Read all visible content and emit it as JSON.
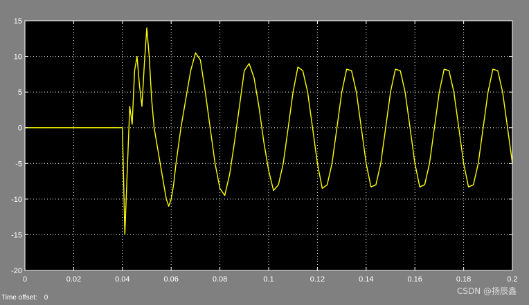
{
  "window": {
    "background": "#808080",
    "plot_background": "#000000",
    "axis_color": "#ffffff",
    "grid_color": "#ffffff",
    "trace_color": "#ffff00"
  },
  "status": {
    "time_offset_label": "Time offset:",
    "time_offset_value": "0"
  },
  "watermark": "CSDN @扬辰鑫",
  "chart_data": {
    "type": "line",
    "title": "",
    "xlabel": "",
    "ylabel": "",
    "xlim": [
      0,
      0.2
    ],
    "ylim": [
      -20,
      15
    ],
    "grid": true,
    "grid_style": "dotted",
    "xticks": [
      0,
      0.02,
      0.04,
      0.06,
      0.08,
      0.1,
      0.12,
      0.14,
      0.16,
      0.18,
      0.2
    ],
    "xtick_labels": [
      "0",
      "0.02",
      "0.04",
      "0.06",
      "0.08",
      "0.1",
      "0.12",
      "0.14",
      "0.16",
      "0.18",
      "0.2"
    ],
    "yticks": [
      -20,
      -15,
      -10,
      -5,
      0,
      5,
      10,
      15
    ],
    "ytick_labels": [
      "-20",
      "-15",
      "-10",
      "-5",
      "0",
      "5",
      "10",
      "15"
    ],
    "series": [
      {
        "color": "#ffff00",
        "x": [
          0,
          0.04,
          0.041,
          0.042,
          0.043,
          0.044,
          0.045,
          0.046,
          0.047,
          0.048,
          0.049,
          0.05,
          0.051,
          0.052,
          0.053,
          0.054,
          0.055,
          0.056,
          0.057,
          0.058,
          0.059,
          0.06,
          0.061,
          0.062,
          0.064,
          0.066,
          0.068,
          0.07,
          0.072,
          0.074,
          0.076,
          0.078,
          0.08,
          0.082,
          0.084,
          0.086,
          0.088,
          0.09,
          0.092,
          0.094,
          0.096,
          0.098,
          0.1,
          0.102,
          0.104,
          0.106,
          0.108,
          0.11,
          0.112,
          0.114,
          0.116,
          0.118,
          0.12,
          0.122,
          0.124,
          0.126,
          0.128,
          0.13,
          0.132,
          0.134,
          0.136,
          0.138,
          0.14,
          0.142,
          0.144,
          0.146,
          0.148,
          0.15,
          0.152,
          0.154,
          0.156,
          0.158,
          0.16,
          0.162,
          0.164,
          0.166,
          0.168,
          0.17,
          0.172,
          0.174,
          0.176,
          0.178,
          0.18,
          0.182,
          0.184,
          0.186,
          0.188,
          0.19,
          0.192,
          0.194,
          0.196,
          0.198,
          0.2
        ],
        "y": [
          0,
          0,
          -15,
          -6,
          3,
          0.5,
          8,
          10,
          6,
          3,
          9,
          14,
          10,
          4,
          0,
          -2,
          -4,
          -6,
          -8,
          -10,
          -11,
          -10,
          -8,
          -5,
          0,
          4,
          8,
          10.5,
          9.5,
          5,
          0,
          -5,
          -8.5,
          -9.5,
          -6.5,
          -2,
          3,
          8,
          9,
          7,
          3,
          -2,
          -6,
          -8.8,
          -8,
          -5,
          0,
          5,
          8.5,
          8,
          5,
          0,
          -5,
          -8.5,
          -8,
          -5,
          0,
          5,
          8.2,
          8,
          5,
          0,
          -5,
          -8.3,
          -8,
          -5,
          0,
          5,
          8.2,
          8,
          5,
          0,
          -5,
          -8.3,
          -8,
          -5,
          0,
          5,
          8.2,
          8,
          5,
          0,
          -5,
          -8.3,
          -8,
          -5,
          0,
          5,
          8.2,
          8,
          5,
          0,
          -5
        ]
      }
    ]
  }
}
